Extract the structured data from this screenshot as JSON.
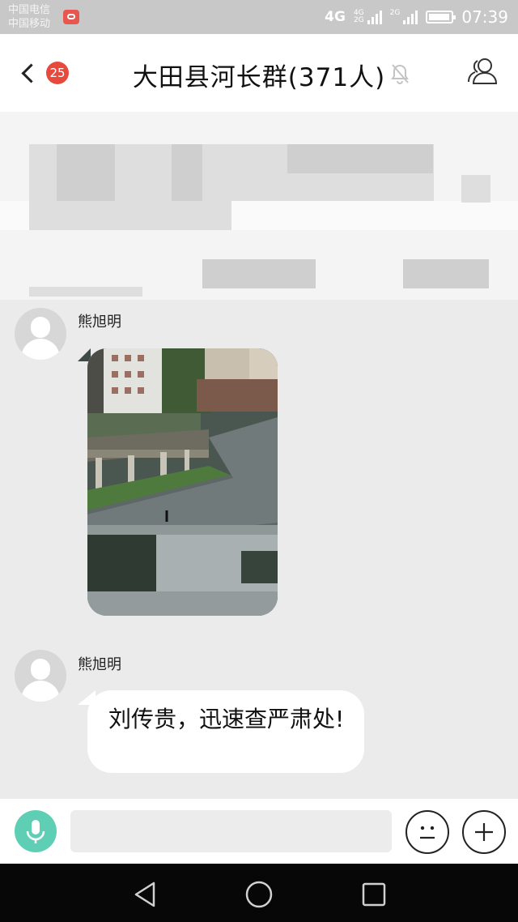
{
  "status_bar": {
    "carrier_1": "中国电信",
    "carrier_2": "中国移动",
    "network_main": "4G",
    "network_4g_small": "4G",
    "network_2g_small": "2G",
    "network_2g_extra": "2G",
    "battery_level": 0.95,
    "time": "07:39",
    "icons": [
      "hd-call-icon",
      "signal-icon",
      "battery-icon"
    ]
  },
  "header": {
    "unread_count": "25",
    "title": "大田县河长群(371人)",
    "icons": [
      "back-icon",
      "mute-bell-icon",
      "group-members-icon"
    ]
  },
  "messages": [
    {
      "sender": "熊旭明",
      "type": "image"
    },
    {
      "sender": "熊旭明",
      "type": "text",
      "text": "刘传贵，迅速查严肃处!"
    }
  ],
  "input_bar": {
    "value": "",
    "icons": [
      "mic-icon",
      "emoji-icon",
      "plus-icon"
    ]
  },
  "nav_bar": {
    "icons": [
      "nav-back-icon",
      "nav-home-icon",
      "nav-recents-icon"
    ]
  },
  "colors": {
    "accent_green": "#5ecfb5",
    "badge_red": "#e8493d",
    "chat_background": "#ebebeb"
  }
}
